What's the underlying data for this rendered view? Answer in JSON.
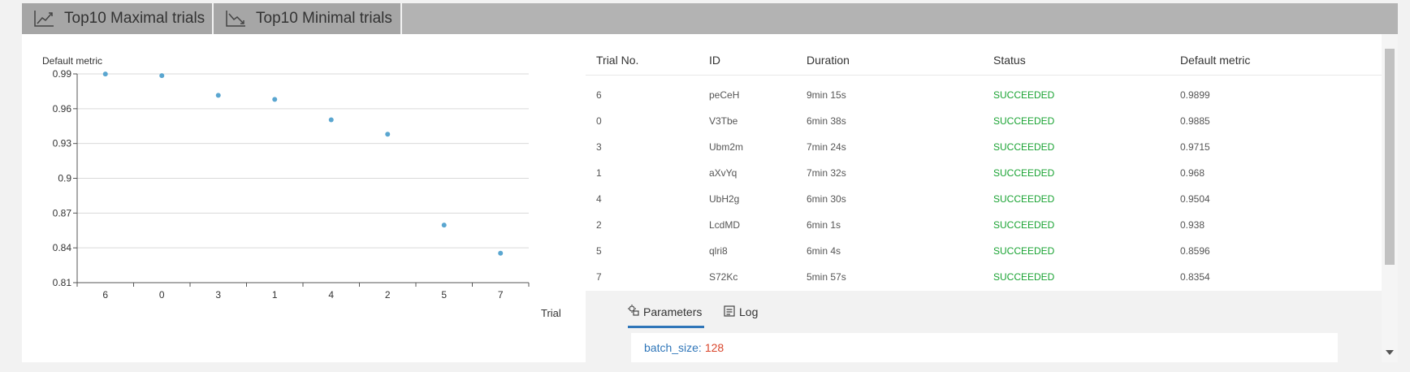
{
  "tabs": {
    "maximal": {
      "label": "Top10 Maximal trials",
      "icon": "trend-up-icon"
    },
    "minimal": {
      "label": "Top10 Minimal trials",
      "icon": "trend-down-icon"
    }
  },
  "chart_data": {
    "type": "scatter",
    "ylabel": "Default metric",
    "xlabel": "Trial",
    "categories": [
      "6",
      "0",
      "3",
      "1",
      "4",
      "2",
      "5",
      "7"
    ],
    "values": [
      0.9899,
      0.9885,
      0.9715,
      0.968,
      0.9504,
      0.938,
      0.8596,
      0.8354
    ],
    "yticks": [
      "0.99",
      "0.96",
      "0.93",
      "0.9",
      "0.87",
      "0.84",
      "0.81"
    ],
    "ylim": [
      0.81,
      0.99
    ],
    "grid": true,
    "color": "#5aa6d0"
  },
  "table": {
    "headers": [
      "Trial No.",
      "ID",
      "Duration",
      "Status",
      "Default metric"
    ],
    "rows": [
      {
        "trial": "6",
        "id": "peCeH",
        "duration": "9min 15s",
        "status": "SUCCEEDED",
        "metric": "0.9899"
      },
      {
        "trial": "0",
        "id": "V3Tbe",
        "duration": "6min 38s",
        "status": "SUCCEEDED",
        "metric": "0.9885"
      },
      {
        "trial": "3",
        "id": "Ubm2m",
        "duration": "7min 24s",
        "status": "SUCCEEDED",
        "metric": "0.9715"
      },
      {
        "trial": "1",
        "id": "aXvYq",
        "duration": "7min 32s",
        "status": "SUCCEEDED",
        "metric": "0.968"
      },
      {
        "trial": "4",
        "id": "UbH2g",
        "duration": "6min 30s",
        "status": "SUCCEEDED",
        "metric": "0.9504"
      },
      {
        "trial": "2",
        "id": "LcdMD",
        "duration": "6min 1s",
        "status": "SUCCEEDED",
        "metric": "0.938"
      },
      {
        "trial": "5",
        "id": "qlri8",
        "duration": "6min 4s",
        "status": "SUCCEEDED",
        "metric": "0.8596"
      },
      {
        "trial": "7",
        "id": "S72Kc",
        "duration": "5min 57s",
        "status": "SUCCEEDED",
        "metric": "0.8354"
      }
    ]
  },
  "detail_tabs": {
    "parameters": {
      "label": "Parameters",
      "icon": "parameters-icon"
    },
    "log": {
      "label": "Log",
      "icon": "log-icon"
    }
  },
  "params": {
    "key": "batch_size:",
    "value": "128"
  },
  "colors": {
    "accent": "#2f76b9",
    "success": "#1aa333",
    "param_value": "#d9452b",
    "tab_bar": "#b3b3b3"
  }
}
